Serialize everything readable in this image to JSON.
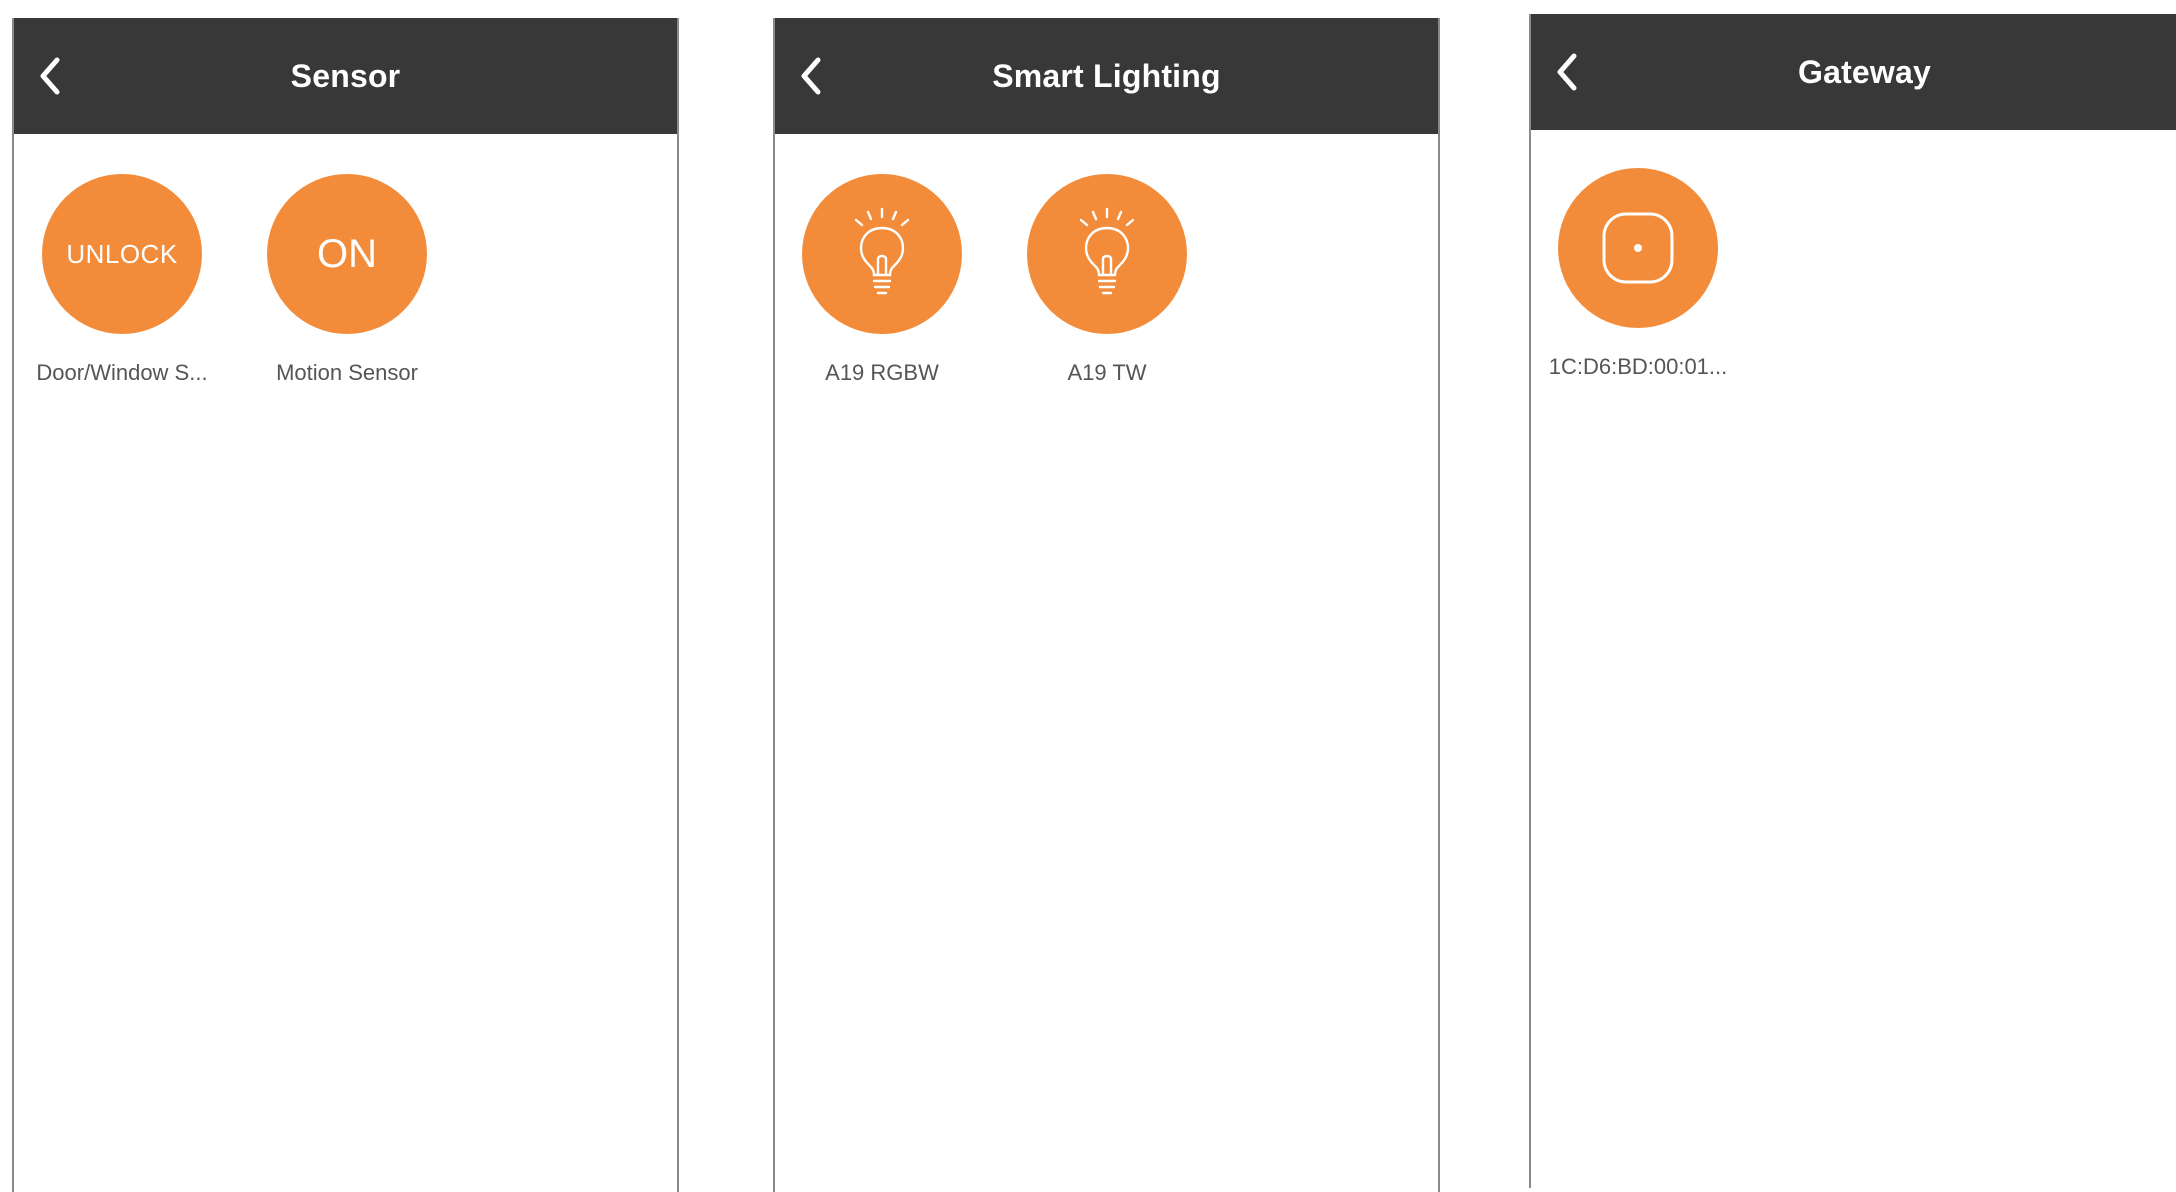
{
  "colors": {
    "nav_background": "#383838",
    "nav_text": "#ffffff",
    "accent": "#f28c3a",
    "label_text": "#555555",
    "page_background": "#ffffff"
  },
  "screens": [
    {
      "title": "Sensor",
      "back_icon": "chevron-left-icon",
      "devices": [
        {
          "state": "UNLOCK",
          "label": "Door/Window S..."
        },
        {
          "state": "ON",
          "label": "Motion Sensor"
        }
      ]
    },
    {
      "title": "Smart Lighting",
      "back_icon": "chevron-left-icon",
      "devices": [
        {
          "icon": "lightbulb-icon",
          "label": "A19 RGBW"
        },
        {
          "icon": "lightbulb-icon",
          "label": "A19 TW"
        }
      ]
    },
    {
      "title": "Gateway",
      "back_icon": "chevron-left-icon",
      "devices": [
        {
          "icon": "gateway-icon",
          "label": "1C:D6:BD:00:01..."
        }
      ]
    }
  ]
}
